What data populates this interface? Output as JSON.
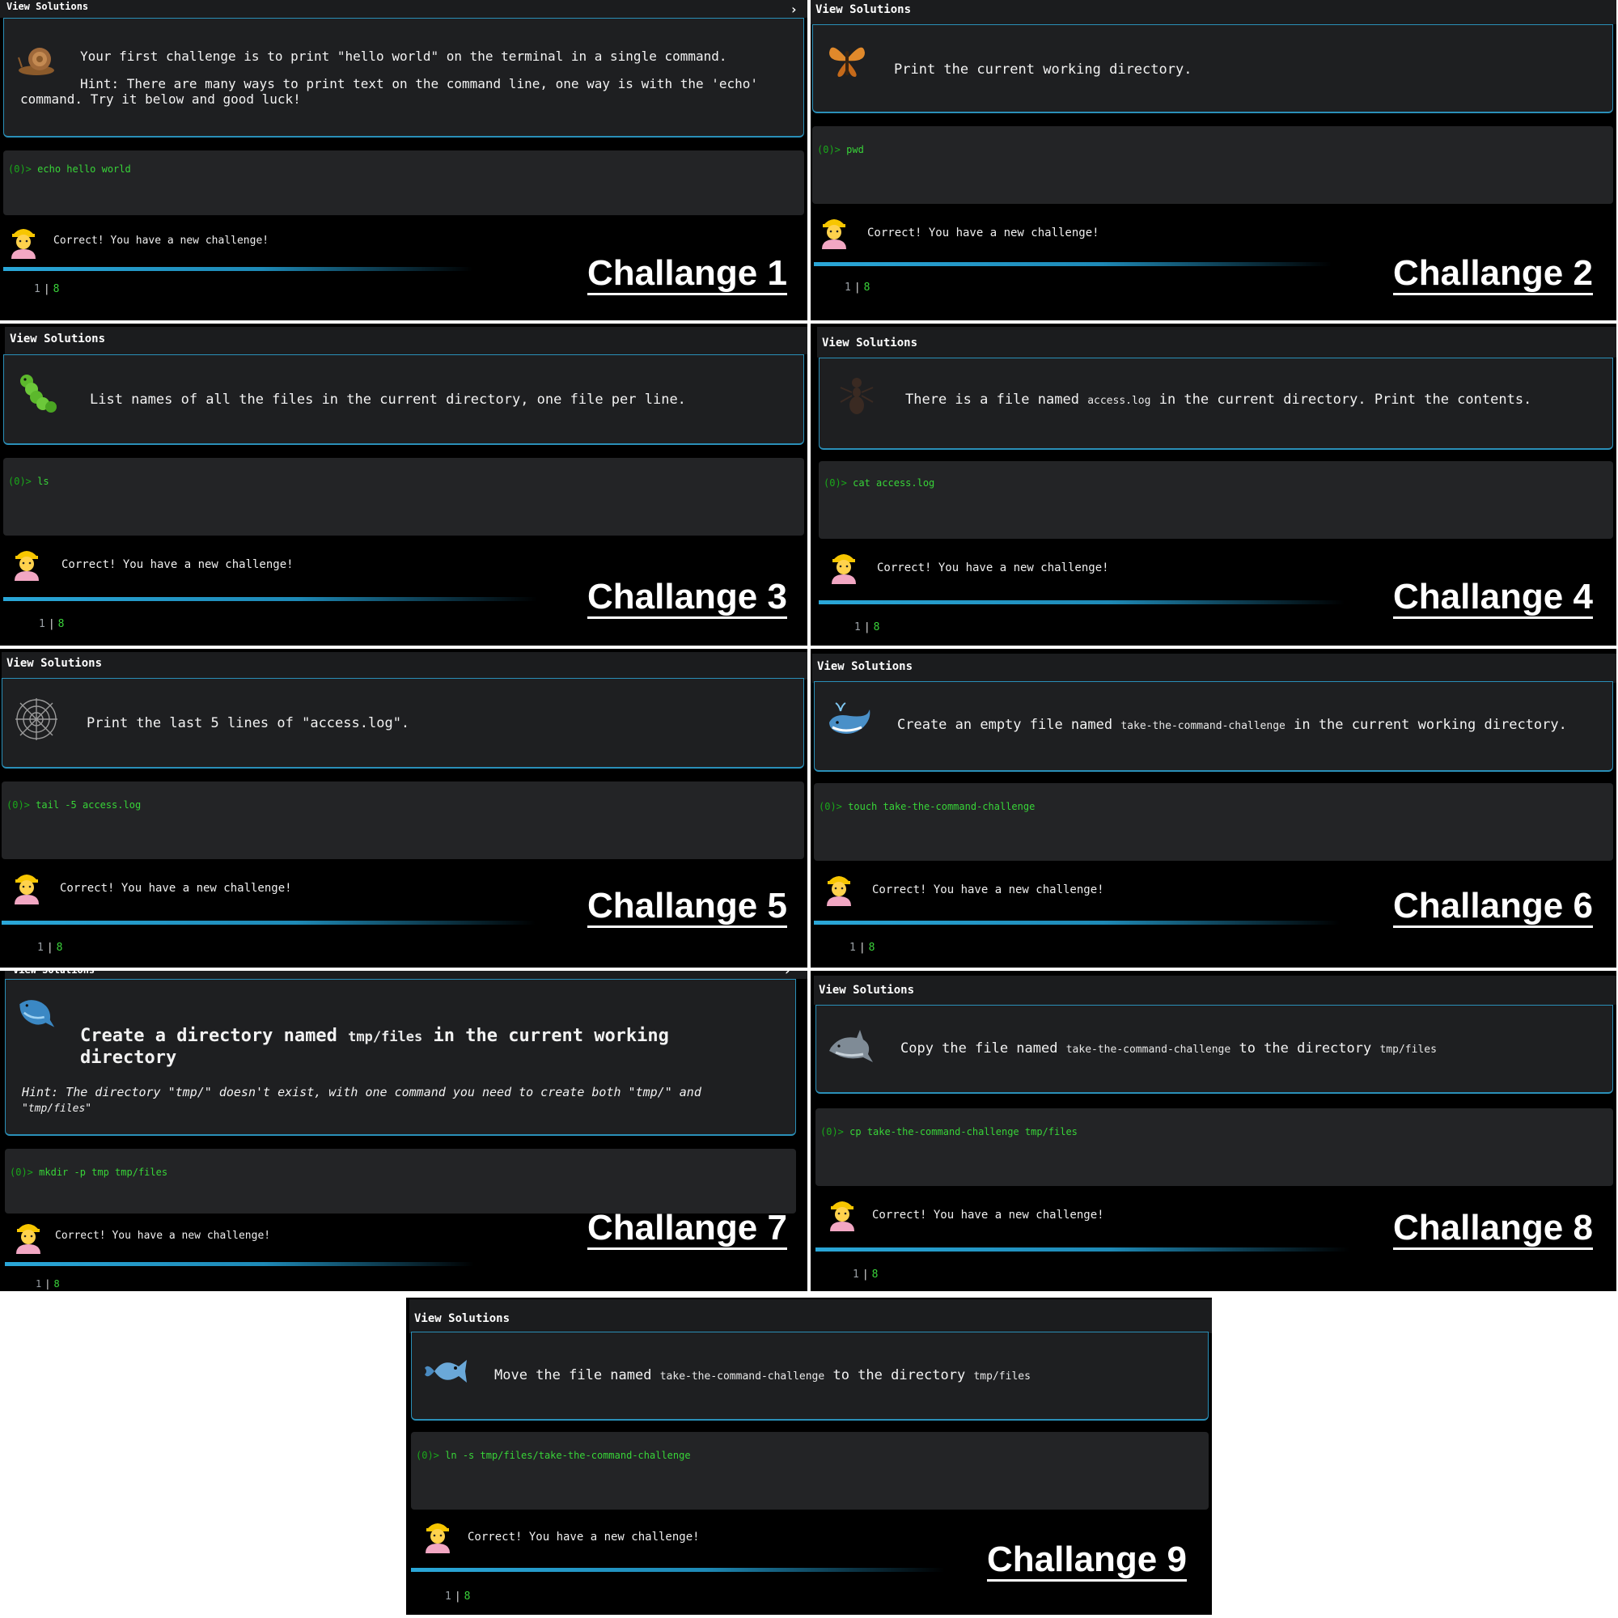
{
  "common": {
    "view_solutions": "View Solutions",
    "prompt_symbol": "(0)>",
    "success_message": "Correct! You have a new challenge!",
    "progress_current": "1",
    "progress_separator": "|",
    "progress_total": "8",
    "progress_fraction": 0.125,
    "accent_color": "#2aa7d8",
    "prompt_color": "#38d438"
  },
  "challenges": [
    {
      "label": "Challange 1",
      "icon": "snail-icon",
      "text_a": "Your first challenge is to print \"hello world\" on the terminal in a single command.",
      "hint_a": "Hint: There are many ways to print text on the command line, one way is with the 'echo'",
      "hint_b": "command. Try it below and good luck!",
      "command": "echo hello world"
    },
    {
      "label": "Challange 2",
      "icon": "butterfly-icon",
      "text_a": "Print the current working directory.",
      "command": "pwd"
    },
    {
      "label": "Challange 3",
      "icon": "caterpillar-icon",
      "text_a": "List names of all the files in the current directory, one file per line.",
      "command": "ls"
    },
    {
      "label": "Challange 4",
      "icon": "ant-icon",
      "text_a": "There is a file named",
      "code_a": "access.log",
      "text_b": "in the current directory. Print the contents.",
      "command": "cat access.log"
    },
    {
      "label": "Challange 5",
      "icon": "spider-web-icon",
      "text_a": "Print the last 5 lines of \"access.log\".",
      "command": "tail -5 access.log"
    },
    {
      "label": "Challange 6",
      "icon": "whale-icon",
      "text_a": "Create an empty file named",
      "code_a": "take-the-command-challenge",
      "text_b": "in the current working directory.",
      "command": "touch take-the-command-challenge"
    },
    {
      "label": "Challange 7",
      "icon": "whale2-icon",
      "text_a": "Create a directory named",
      "code_a": "tmp/files",
      "text_b": "in the current working",
      "text_c": "directory",
      "hint_a": "Hint: The directory \"tmp/\" doesn't exist, with one command you need to create both \"tmp/\" and",
      "hint_b": "\"tmp/files\"",
      "command": "mkdir -p tmp tmp/files"
    },
    {
      "label": "Challange 8",
      "icon": "dolphin-icon",
      "text_a": "Copy the file named",
      "code_a": "take-the-command-challenge",
      "text_b": "to the directory",
      "code_b": "tmp/files",
      "command": "cp take-the-command-challenge tmp/files"
    },
    {
      "label": "Challange 9",
      "icon": "fish-icon",
      "text_a": "Move the file named",
      "code_a": "take-the-command-challenge",
      "text_b": "to the directory",
      "code_b": "tmp/files",
      "command": "ln -s tmp/files/take-the-command-challenge"
    }
  ]
}
